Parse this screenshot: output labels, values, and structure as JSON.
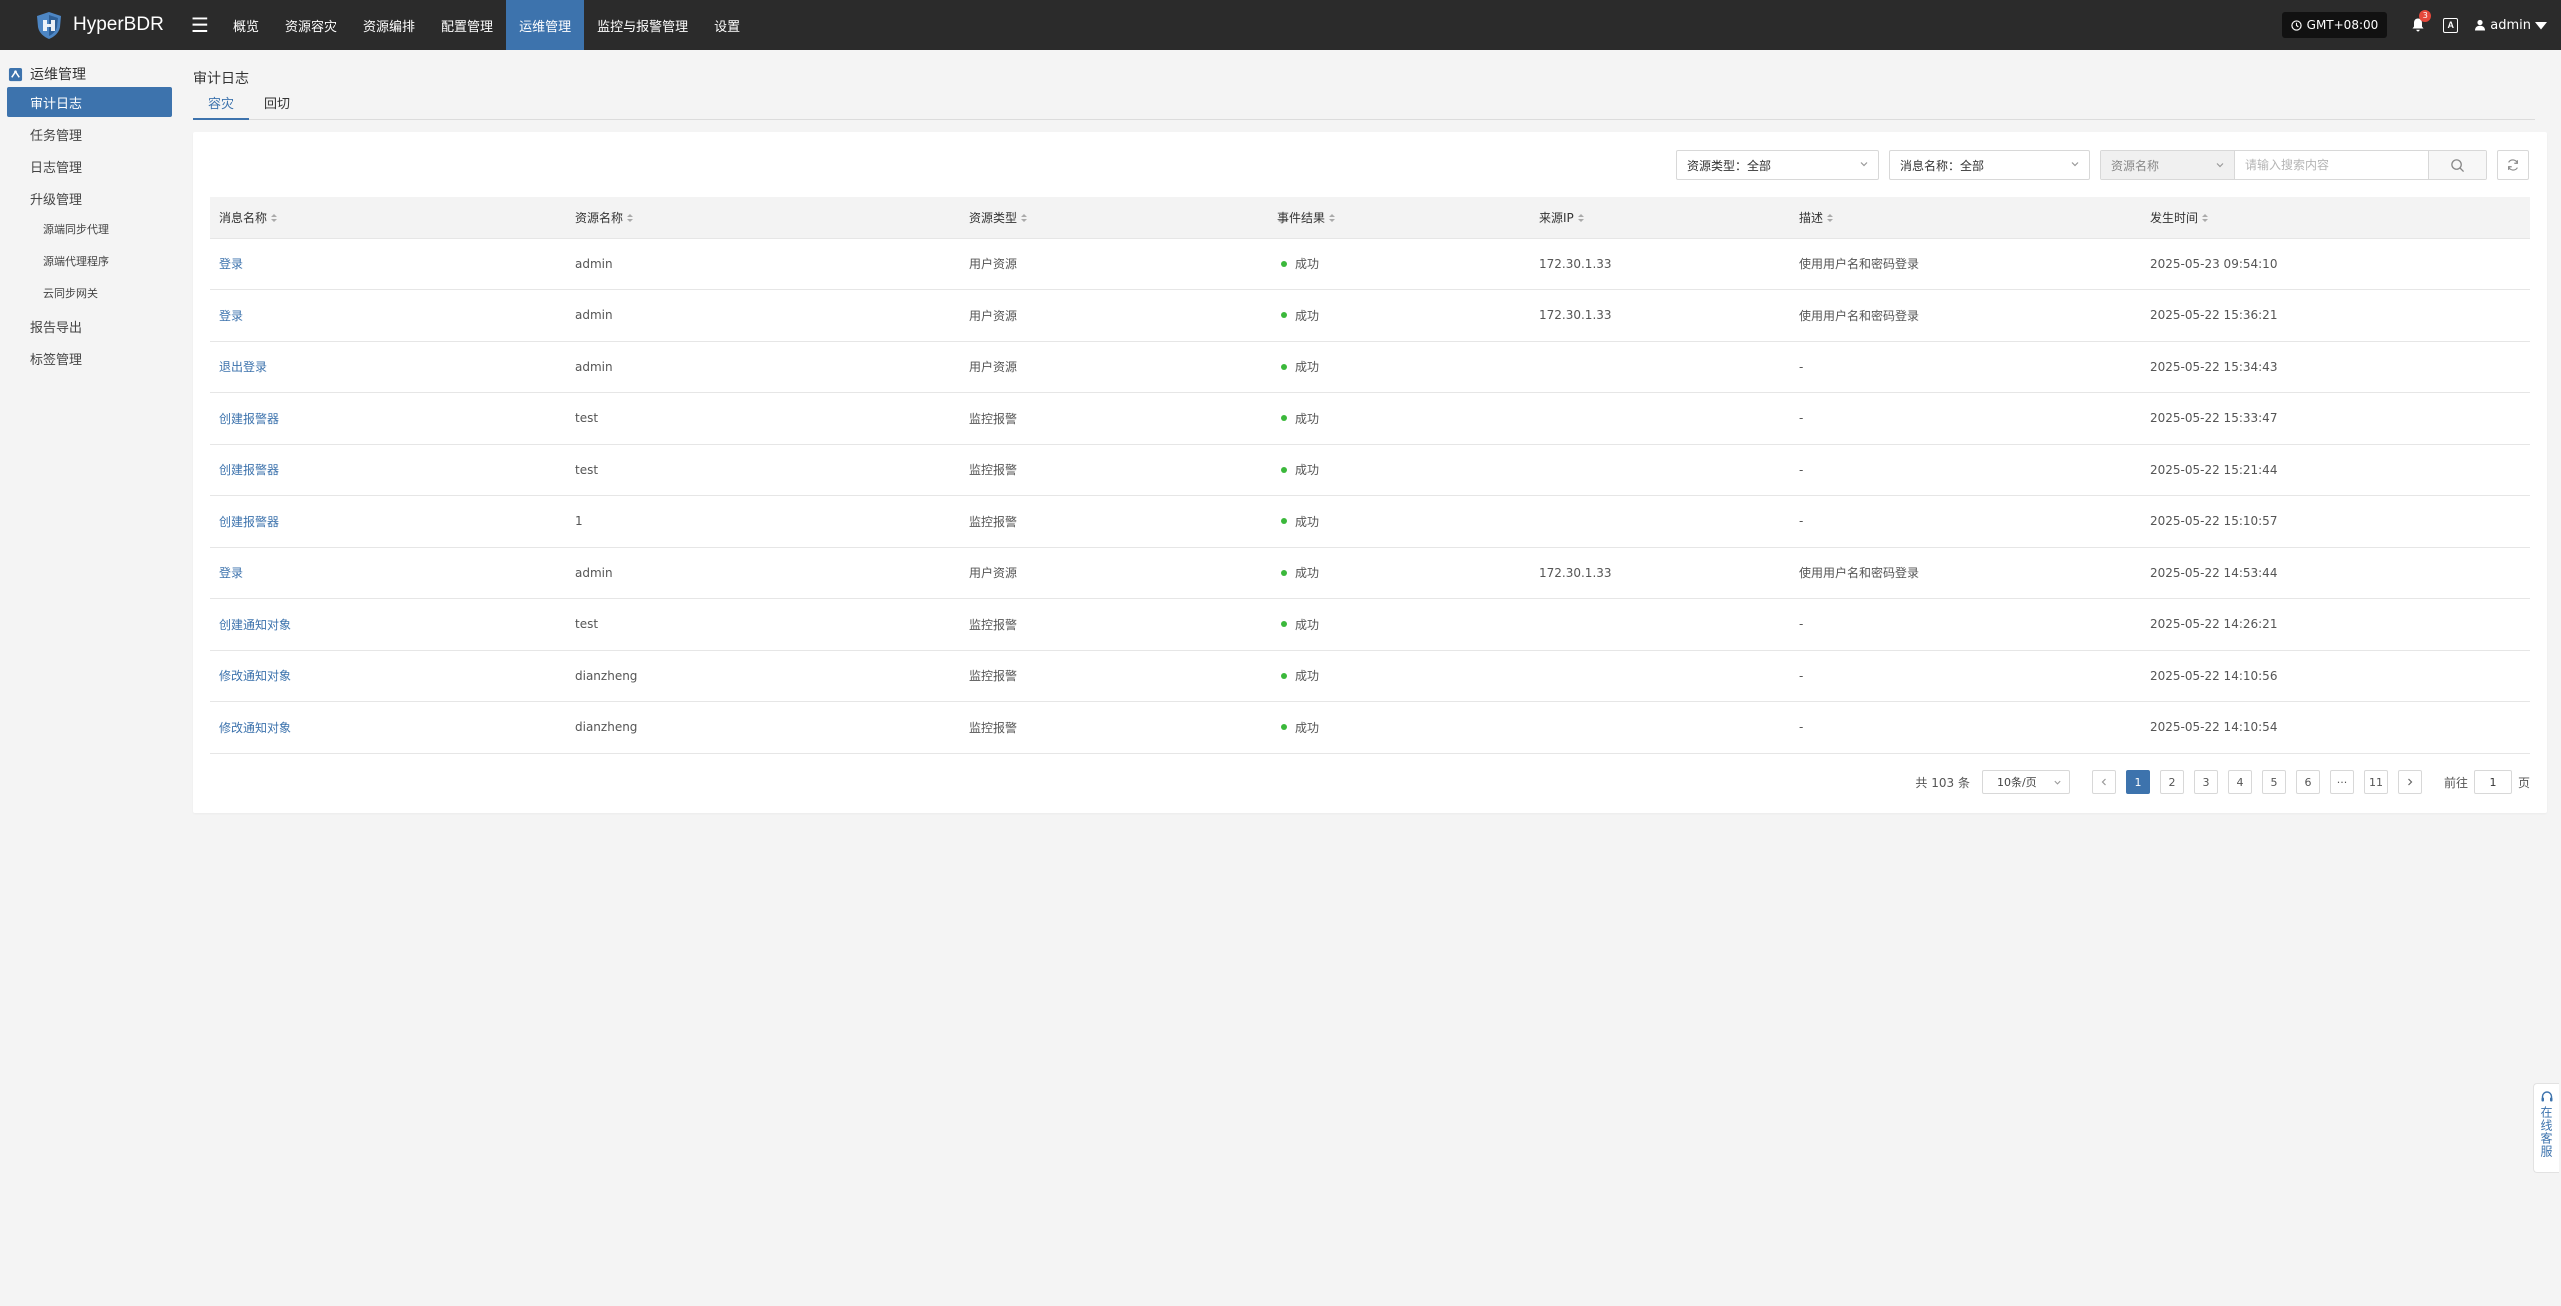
{
  "app": {
    "name": "HyperBDR"
  },
  "topnav": {
    "items": [
      {
        "label": "概览",
        "active": false
      },
      {
        "label": "资源容灾",
        "active": false
      },
      {
        "label": "资源编排",
        "active": false
      },
      {
        "label": "配置管理",
        "active": false
      },
      {
        "label": "运维管理",
        "active": true
      },
      {
        "label": "监控与报警管理",
        "active": false
      },
      {
        "label": "设置",
        "active": false
      }
    ],
    "timezone": "GMT+08:00",
    "notification_count": "3",
    "language_icon": "A",
    "user": "admin"
  },
  "sidebar": {
    "header": "运维管理",
    "items": [
      {
        "label": "审计日志",
        "active": true,
        "level": 1
      },
      {
        "label": "任务管理",
        "active": false,
        "level": 1
      },
      {
        "label": "日志管理",
        "active": false,
        "level": 1
      },
      {
        "label": "升级管理",
        "active": false,
        "level": 1
      },
      {
        "label": "源端同步代理",
        "active": false,
        "level": 2
      },
      {
        "label": "源端代理程序",
        "active": false,
        "level": 2
      },
      {
        "label": "云同步网关",
        "active": false,
        "level": 2
      },
      {
        "label": "报告导出",
        "active": false,
        "level": 1
      },
      {
        "label": "标签管理",
        "active": false,
        "level": 1
      }
    ]
  },
  "page": {
    "title": "审计日志",
    "tabs": [
      {
        "label": "容灾",
        "active": true
      },
      {
        "label": "回切",
        "active": false
      }
    ]
  },
  "filters": {
    "resource_type": "资源类型：全部",
    "message_name": "消息名称：全部",
    "search_field": "资源名称",
    "search_placeholder": "请输入搜索内容"
  },
  "table": {
    "columns": [
      "消息名称",
      "资源名称",
      "资源类型",
      "事件结果",
      "来源IP",
      "描述",
      "发生时间"
    ],
    "rows": [
      {
        "message": "登录",
        "resource": "admin",
        "type": "用户资源",
        "result": "成功",
        "ip": "172.30.1.33",
        "desc": "使用用户名和密码登录",
        "time": "2025-05-23 09:54:10"
      },
      {
        "message": "登录",
        "resource": "admin",
        "type": "用户资源",
        "result": "成功",
        "ip": "172.30.1.33",
        "desc": "使用用户名和密码登录",
        "time": "2025-05-22 15:36:21"
      },
      {
        "message": "退出登录",
        "resource": "admin",
        "type": "用户资源",
        "result": "成功",
        "ip": "",
        "desc": "-",
        "time": "2025-05-22 15:34:43"
      },
      {
        "message": "创建报警器",
        "resource": "test",
        "type": "监控报警",
        "result": "成功",
        "ip": "",
        "desc": "-",
        "time": "2025-05-22 15:33:47"
      },
      {
        "message": "创建报警器",
        "resource": "test",
        "type": "监控报警",
        "result": "成功",
        "ip": "",
        "desc": "-",
        "time": "2025-05-22 15:21:44"
      },
      {
        "message": "创建报警器",
        "resource": "1",
        "type": "监控报警",
        "result": "成功",
        "ip": "",
        "desc": "-",
        "time": "2025-05-22 15:10:57"
      },
      {
        "message": "登录",
        "resource": "admin",
        "type": "用户资源",
        "result": "成功",
        "ip": "172.30.1.33",
        "desc": "使用用户名和密码登录",
        "time": "2025-05-22 14:53:44"
      },
      {
        "message": "创建通知对象",
        "resource": "test",
        "type": "监控报警",
        "result": "成功",
        "ip": "",
        "desc": "-",
        "time": "2025-05-22 14:26:21"
      },
      {
        "message": "修改通知对象",
        "resource": "dianzheng",
        "type": "监控报警",
        "result": "成功",
        "ip": "",
        "desc": "-",
        "time": "2025-05-22 14:10:56"
      },
      {
        "message": "修改通知对象",
        "resource": "dianzheng",
        "type": "监控报警",
        "result": "成功",
        "ip": "",
        "desc": "-",
        "time": "2025-05-22 14:10:54"
      }
    ]
  },
  "pagination": {
    "total": "共 103 条",
    "page_size": "10条/页",
    "pages": [
      "1",
      "2",
      "3",
      "4",
      "5",
      "6",
      "···",
      "11"
    ],
    "current": "1",
    "goto_prefix": "前往",
    "goto_value": "1",
    "goto_suffix": "页"
  },
  "floating": {
    "label": "在线客服"
  },
  "colors": {
    "accent": "#3d73ad",
    "topbar": "#2b2b2b",
    "success": "#3bb83b",
    "badge": "#e5483b"
  }
}
